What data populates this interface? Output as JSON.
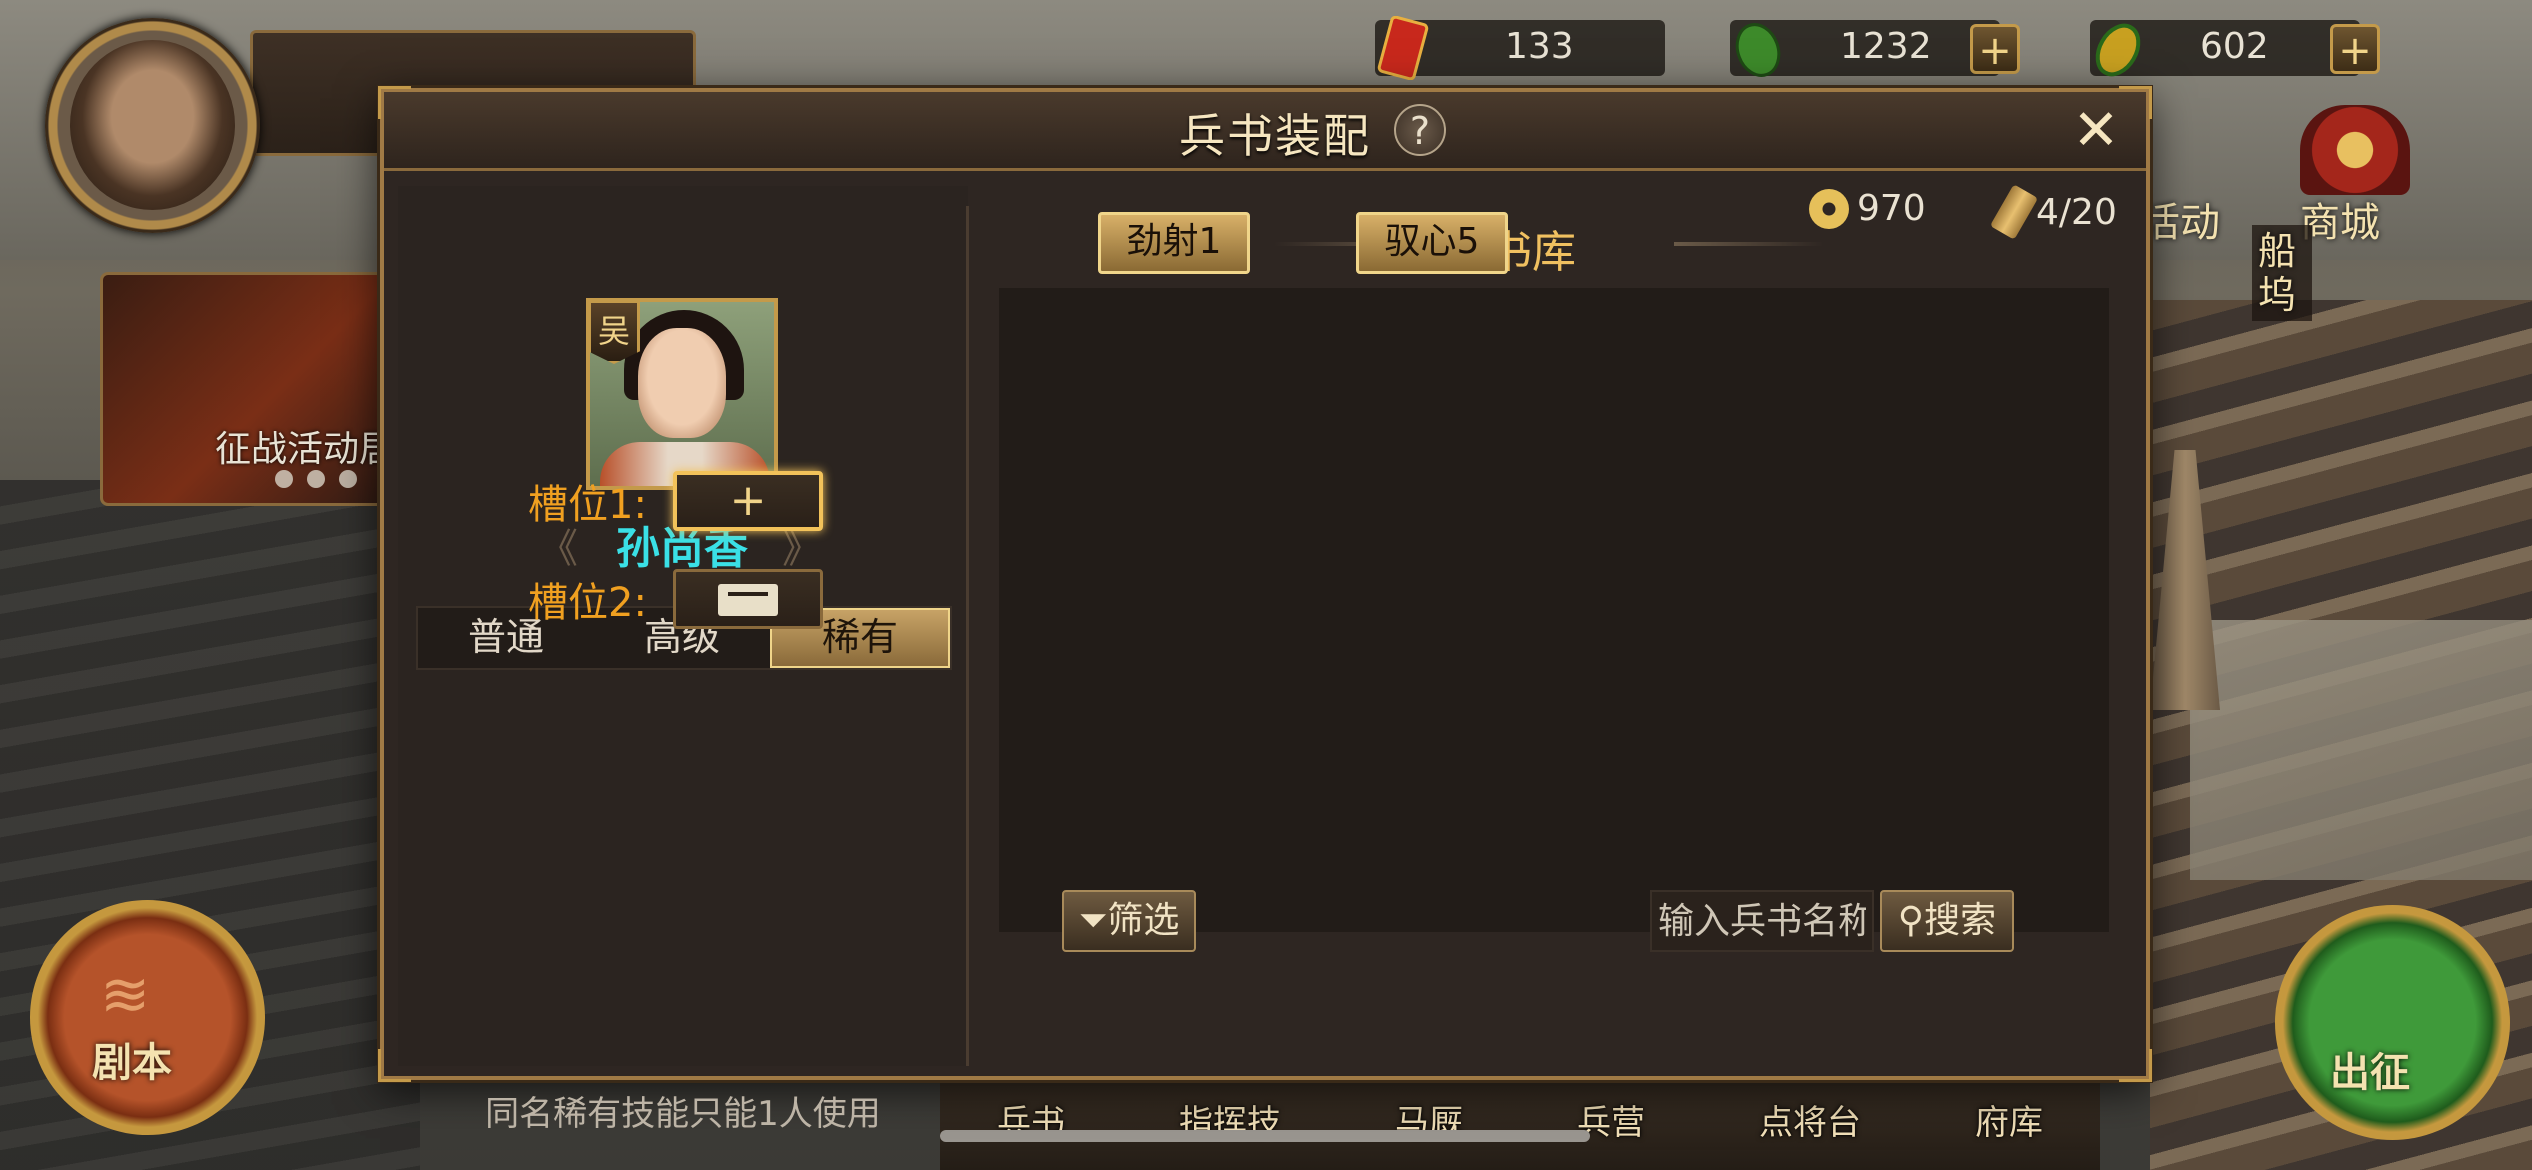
{
  "resources": [
    {
      "value": "133",
      "icon": "red-token-icon",
      "color": "#c8281c",
      "has_plus": false
    },
    {
      "value": "1232",
      "icon": "green-jade-icon",
      "color": "#3d8a2a",
      "has_plus": true
    },
    {
      "value": "602",
      "icon": "yellow-jade-icon",
      "color": "#c8a020",
      "has_plus": true
    }
  ],
  "hud": {
    "event_label": "征战活动居",
    "juben": "剧本",
    "chuzheng": "出征",
    "huodong": "活动",
    "shangcheng": "商城",
    "chuanwu": "船坞"
  },
  "bottom_nav": [
    "兵书",
    "指挥技",
    "马厩",
    "兵营",
    "点将台",
    "府库"
  ],
  "modal": {
    "title": "兵书装配",
    "help": "?",
    "close": "✕",
    "hero": {
      "faction": "吴",
      "name": "孙尚香"
    },
    "tabs": [
      "普通",
      "高级",
      "稀有"
    ],
    "active_tab": "稀有",
    "slots": [
      {
        "label": "槽位1:",
        "state": "empty",
        "glyph": "+"
      },
      {
        "label": "槽位2:",
        "state": "locked",
        "glyph": ""
      }
    ],
    "note": "同名稀有技能只能1人使用",
    "coins": "970",
    "books_count": "4/20",
    "library_title": "兵书库",
    "books": [
      "劲射1",
      "驭心5"
    ],
    "filter_label": "筛选",
    "search_placeholder": "输入兵书名称",
    "search_label": "搜索"
  },
  "colors": {
    "accent_gold": "#c49a4a",
    "hero_name": "#3ae0e6",
    "slot_label": "#f0a020",
    "library_title": "#f0c060"
  }
}
